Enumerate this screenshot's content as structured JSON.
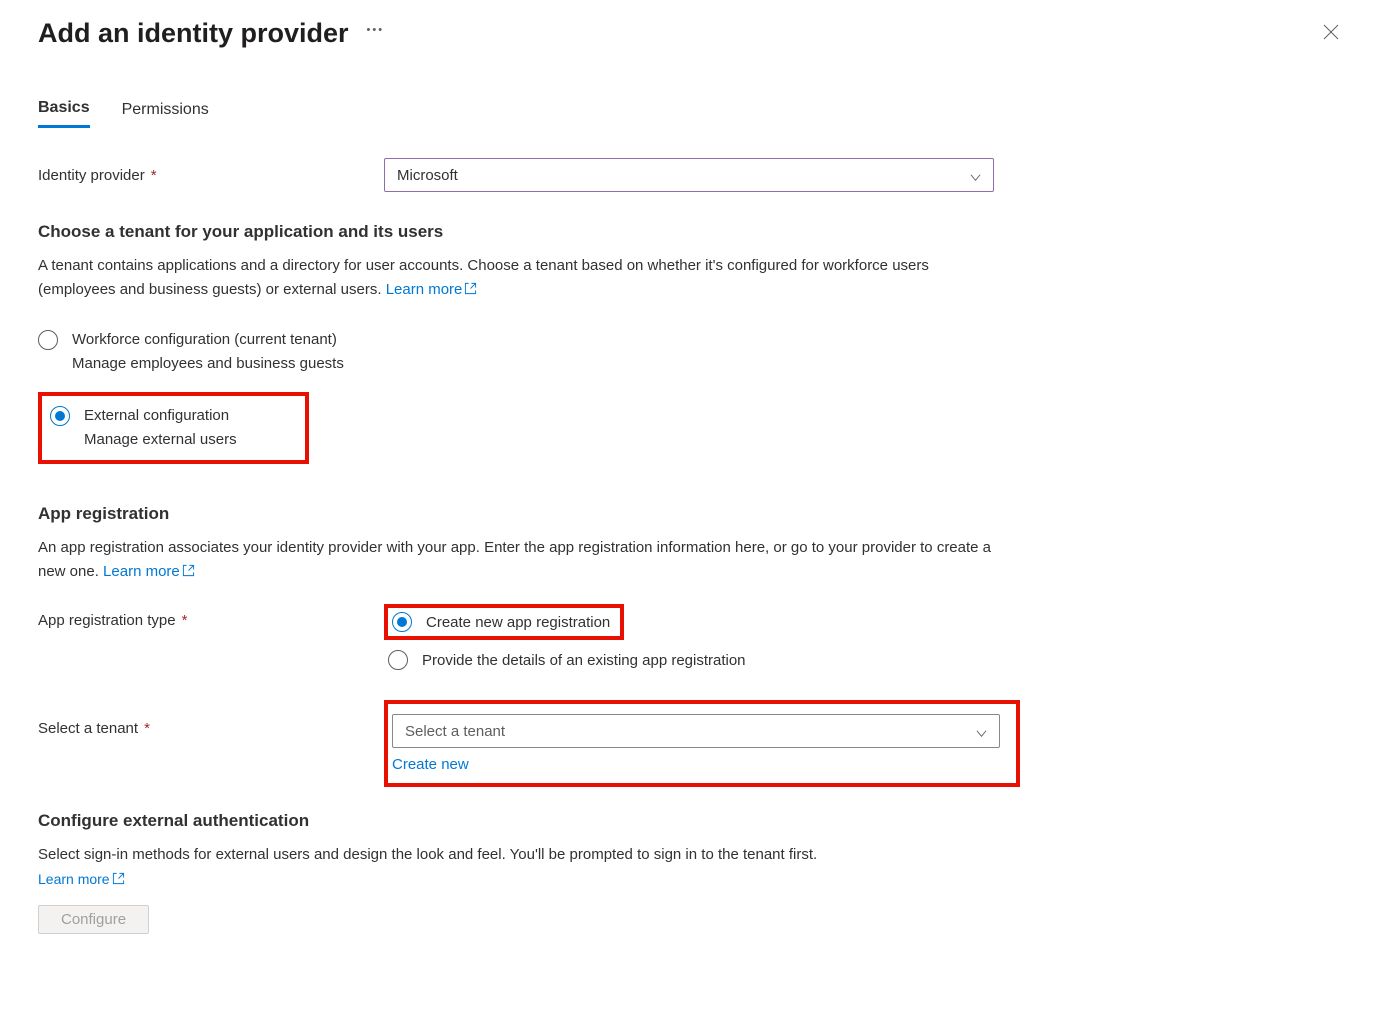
{
  "header": {
    "title": "Add an identity provider"
  },
  "tabs": {
    "basics": "Basics",
    "permissions": "Permissions"
  },
  "identityProvider": {
    "label": "Identity provider",
    "value": "Microsoft"
  },
  "tenantSection": {
    "heading": "Choose a tenant for your application and its users",
    "desc": "A tenant contains applications and a directory for user accounts. Choose a tenant based on whether it's configured for workforce users (employees and business guests) or external users. ",
    "learnMore": "Learn more",
    "options": {
      "workforce": {
        "label": "Workforce configuration (current tenant)",
        "sub": "Manage employees and business guests"
      },
      "external": {
        "label": "External configuration",
        "sub": "Manage external users"
      }
    }
  },
  "appReg": {
    "heading": "App registration",
    "desc": "An app registration associates your identity provider with your app. Enter the app registration information here, or go to your provider to create a new one. ",
    "learnMore": "Learn more",
    "typeLabel": "App registration type",
    "options": {
      "createNew": "Create new app registration",
      "existing": "Provide the details of an existing app registration"
    },
    "selectTenantLabel": "Select a tenant",
    "selectTenantPlaceholder": "Select a tenant",
    "createNewLink": "Create new"
  },
  "externalAuth": {
    "heading": "Configure external authentication",
    "desc": "Select sign-in methods for external users and design the look and feel. You'll be prompted to sign in to the tenant first.",
    "learnMore": "Learn more",
    "configureBtn": "Configure"
  }
}
